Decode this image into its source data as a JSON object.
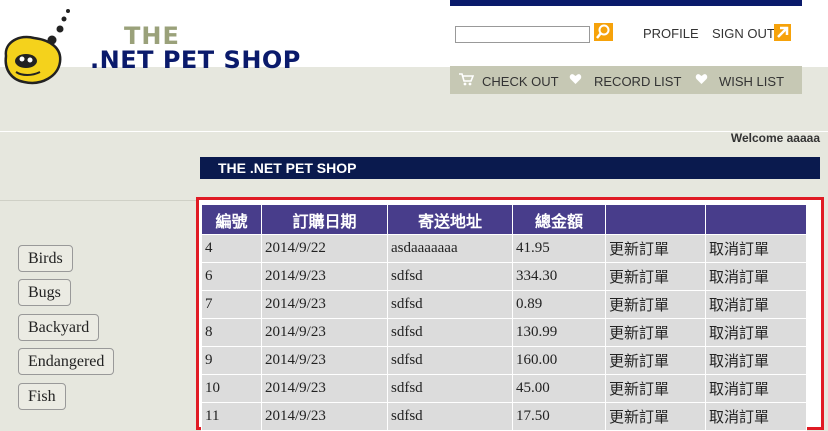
{
  "logo": {
    "line1": "THE",
    "line2": ".NET PET SHOP"
  },
  "header": {
    "search_placeholder": "",
    "profile_label": "PROFILE",
    "signout_label": "SIGN OUT",
    "checkout_label": "CHECK OUT",
    "record_list_label": "RECORD LIST",
    "wish_list_label": "WISH LIST",
    "welcome_text": "Welcome aaaaa"
  },
  "section_title": "THE .NET PET SHOP",
  "categories": [
    "Birds",
    "Bugs",
    "Backyard",
    "Endangered",
    "Fish"
  ],
  "orders": {
    "headers": [
      "編號",
      "訂購日期",
      "寄送地址",
      "總金額",
      "",
      ""
    ],
    "rows": [
      [
        "4",
        "2014/9/22",
        "asdaaaaaaa",
        "41.95",
        "更新訂單",
        "取消訂單"
      ],
      [
        "6",
        "2014/9/23",
        "sdfsd",
        "334.30",
        "更新訂單",
        "取消訂單"
      ],
      [
        "7",
        "2014/9/23",
        "sdfsd",
        "0.89",
        "更新訂單",
        "取消訂單"
      ],
      [
        "8",
        "2014/9/23",
        "sdfsd",
        "130.99",
        "更新訂單",
        "取消訂單"
      ],
      [
        "9",
        "2014/9/23",
        "sdfsd",
        "160.00",
        "更新訂單",
        "取消訂單"
      ],
      [
        "10",
        "2014/9/23",
        "sdfsd",
        "45.00",
        "更新訂單",
        "取消訂單"
      ],
      [
        "11",
        "2014/9/23",
        "sdfsd",
        "17.50",
        "更新訂單",
        "取消訂單"
      ]
    ]
  },
  "colors": {
    "navy": "#0a1a4e",
    "header_purple": "#483d8b",
    "accent_orange": "#f6a20a",
    "highlight_red": "#e01b24"
  }
}
